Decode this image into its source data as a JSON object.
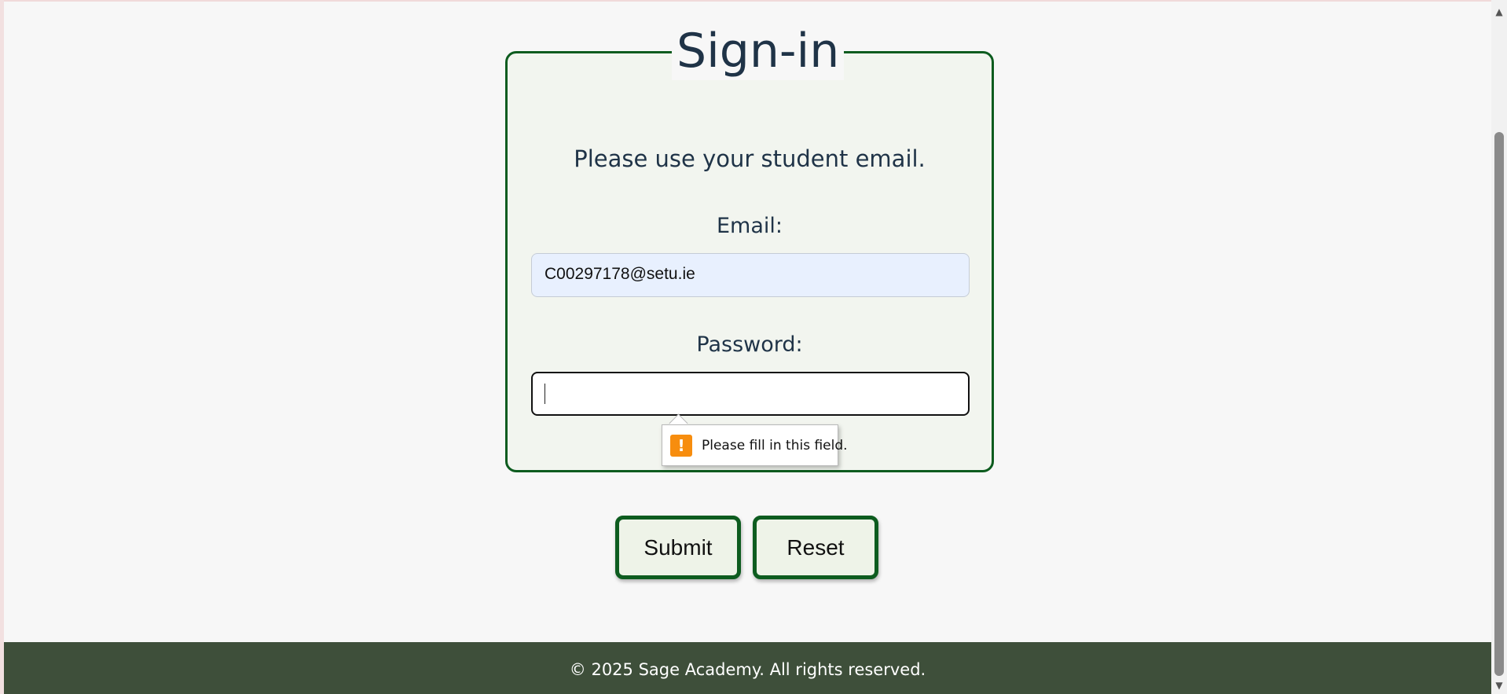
{
  "form": {
    "legend": "Sign-in",
    "hint": "Please use your student email.",
    "email_label": "Email:",
    "email_value": "C00297178@setu.ie",
    "password_label": "Password:",
    "password_value": ""
  },
  "validation": {
    "icon": "!",
    "message": "Please fill in this field."
  },
  "buttons": {
    "submit": "Submit",
    "reset": "Reset"
  },
  "footer": {
    "text": "© 2025 Sage Academy. All rights reserved."
  },
  "scrollbar": {
    "up_icon": "▲",
    "down_icon": "▼"
  },
  "colors": {
    "accent_green": "#0d5c1f",
    "footer_bg": "#3e4f3a",
    "text_navy": "#1f3347",
    "warning_orange": "#f78d0e"
  }
}
